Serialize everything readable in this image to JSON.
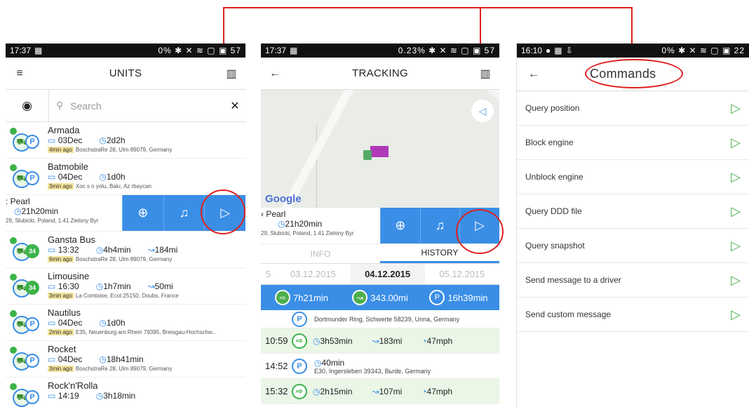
{
  "colors": {
    "accent": "#3a8ee6",
    "green": "#4cae4c",
    "highlight": "#e02020"
  },
  "units_screen": {
    "status": {
      "time": "17:37",
      "right": "0% ✱ ✕ ≋ ▢ ▣ 57"
    },
    "title": "UNITS",
    "search_placeholder": "Search",
    "units": [
      {
        "name": "Armada",
        "date": "03Dec",
        "dur": "2d2h",
        "tag": "4min ago",
        "addr": "BoschstraRe 28, Ulm 89079, Germany",
        "badge": "P"
      },
      {
        "name": "Batmobile",
        "date": "04Dec",
        "dur": "1d0h",
        "tag": "3min ago",
        "addr": "Xoc s n yolu, Bakı, Az rbaycan",
        "badge": "P"
      },
      {
        "name": "Gansta Bus",
        "date": "13:32",
        "dur": "4h4min",
        "dist": "184mi",
        "tag": "6min ago",
        "addr": "BoschstraRe 28, Ulm 89079, Germany",
        "badge": "34"
      },
      {
        "name": "Limousine",
        "date": "16:30",
        "dur": "1h7min",
        "dist": "50mi",
        "tag": "3min ago",
        "addr": "La Comtoise, Ecot 25150, Doubs, France",
        "badge": "34"
      },
      {
        "name": "Nautilus",
        "date": "04Dec",
        "dur": "1d0h",
        "tag": "2min ago",
        "addr": "E35, Neuenburg am Rhein 79395, Breisgau-Hochschw...",
        "badge": "P"
      },
      {
        "name": "Rocket",
        "date": "04Dec",
        "dur": "18h41min",
        "tag": "3min ago",
        "addr": "BoschstraRe 28, Ulm 89079, Germany",
        "badge": "P"
      },
      {
        "name": "Rock'n'Rolla",
        "date": "14:19",
        "dur": "3h18min",
        "tag": "",
        "addr": "",
        "badge": "P"
      }
    ],
    "swipe": {
      "name": ": Pearl",
      "dur": "21h20min",
      "addr": "29, Słubicki, Poland, 1.41 Zielony Byr"
    }
  },
  "tracking_screen": {
    "status": {
      "time": "17:37",
      "right": "0.23% ✱ ✕ ≋ ▢ ▣ 57"
    },
    "title": "TRACKING",
    "map_brand": "Google",
    "swipe": {
      "name": "‹ Pearl",
      "dur": "21h20min",
      "addr": "29, Słubicki, Poland, 1.41 Zielony Byr"
    },
    "tabs": [
      "INFO",
      "HISTORY"
    ],
    "dates": [
      "5",
      "03.12.2015",
      "04.12.2015",
      "05.12.2015",
      "5"
    ],
    "summary": [
      "7h21min",
      "343.00mi",
      "16h39min"
    ],
    "history": [
      {
        "time": "",
        "kind": "P",
        "text": "Dortmunder Ring, Schwerte 58239, Unna, Germany"
      },
      {
        "time": "10:59",
        "kind": "drive",
        "dur": "3h53min",
        "dist": "183mi",
        "speed": "47mph"
      },
      {
        "time": "14:52",
        "kind": "P",
        "dur": "40min",
        "text": "E30, Ingersleben 39343, Bьrde, Germany"
      },
      {
        "time": "15:32",
        "kind": "drive",
        "dur": "2h15min",
        "dist": "107mi",
        "speed": "47mph"
      }
    ]
  },
  "commands_screen": {
    "status": {
      "time": "16:10",
      "right": "0% ✱ ✕ ≋ ▢ ▣ 22"
    },
    "title": "Commands",
    "commands": [
      "Query position",
      "Block engine",
      "Unblock engine",
      "Query DDD file",
      "Query snapshot",
      "Send message to a driver",
      "Send custom message"
    ]
  }
}
